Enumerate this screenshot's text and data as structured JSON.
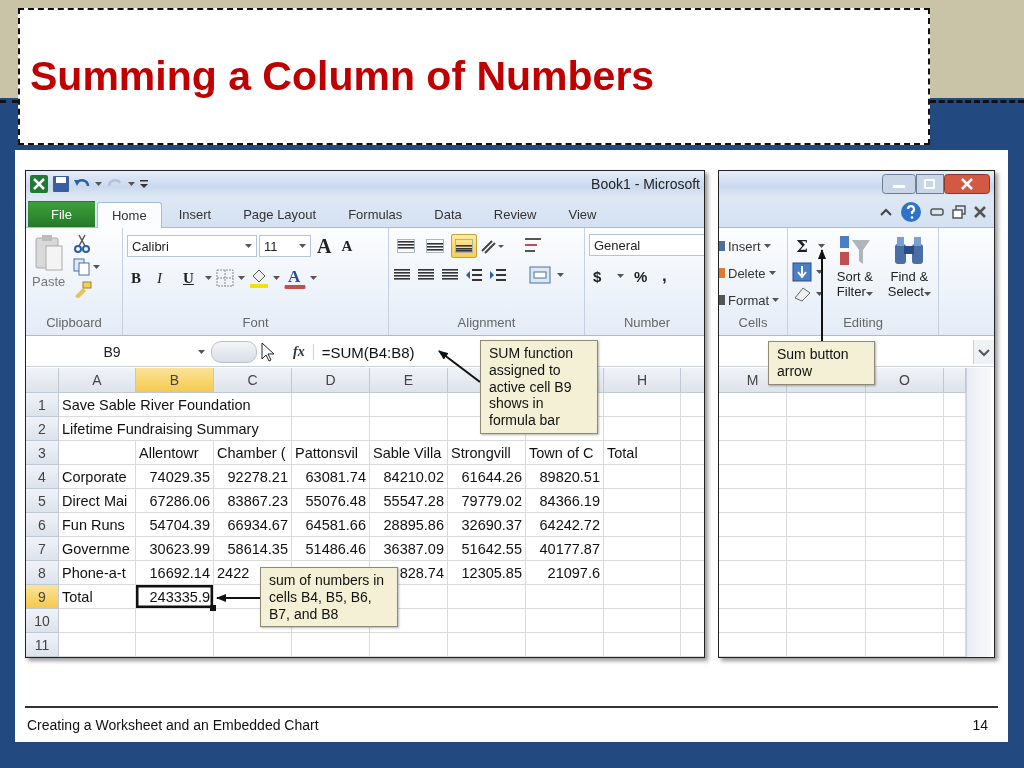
{
  "slide": {
    "title": "Summing a Column of Numbers",
    "footer": "Creating a Worksheet and an Embedded Chart",
    "page": "14"
  },
  "window": {
    "title": "Book1 - Microsoft"
  },
  "tabs": [
    {
      "label": "File",
      "kind": "file",
      "selected": false
    },
    {
      "label": "Home",
      "kind": "tab",
      "selected": true
    },
    {
      "label": "Insert",
      "kind": "tab",
      "selected": false
    },
    {
      "label": "Page Layout",
      "kind": "tab",
      "selected": false
    },
    {
      "label": "Formulas",
      "kind": "tab",
      "selected": false
    },
    {
      "label": "Data",
      "kind": "tab",
      "selected": false
    },
    {
      "label": "Review",
      "kind": "tab",
      "selected": false
    },
    {
      "label": "View",
      "kind": "tab",
      "selected": false
    }
  ],
  "ribbon": {
    "clipboard": {
      "label": "Clipboard",
      "paste": "Paste"
    },
    "font": {
      "label": "Font",
      "name": "Calibri",
      "size": "11",
      "size_buttons": [
        "A",
        "A"
      ],
      "style_buttons": [
        "B",
        "I",
        "U"
      ],
      "color_button": "A"
    },
    "alignment": {
      "label": "Alignment",
      "vertical": [
        {
          "selected": false
        },
        {
          "selected": false
        },
        {
          "selected": true
        }
      ]
    },
    "number": {
      "label": "Number",
      "format": "General",
      "buttons": [
        "$",
        "%",
        ","
      ]
    },
    "cells": {
      "label": "Cells",
      "items": [
        "Insert",
        "Delete",
        "Format"
      ]
    },
    "editing": {
      "label": "Editing",
      "sum": "Σ",
      "buttons": [
        "Sort & Filter",
        "Find & Select"
      ]
    }
  },
  "formula_bar": {
    "name_box": "B9",
    "function_label": "fx",
    "formula": "=SUM(B4:B8)"
  },
  "sheet": {
    "columns": [
      {
        "label": "A",
        "selected": false
      },
      {
        "label": "B",
        "selected": true
      },
      {
        "label": "C",
        "selected": false
      },
      {
        "label": "D",
        "selected": false
      },
      {
        "label": "E",
        "selected": false
      },
      {
        "label": "H",
        "selected": false
      }
    ],
    "right_columns": [
      "M",
      "O"
    ],
    "rows": [
      {
        "header": "1",
        "selected": false,
        "kind": "text",
        "cells": [
          "Save Sable River Foundation",
          null,
          null
        ]
      },
      {
        "header": "2",
        "selected": false,
        "kind": "text",
        "cells": [
          "Lifetime Fundraising Summary",
          null,
          null
        ]
      },
      {
        "header": "3",
        "selected": false,
        "kind": "text",
        "cells": [
          null,
          "Allentowr",
          "Chamber (",
          "Pattonsvil",
          "Sable Villa",
          "Strongvill",
          "Town of C",
          "Total"
        ]
      },
      {
        "header": "4",
        "selected": false,
        "kind": "numbers",
        "cells": [
          "Corporate",
          "74029.35",
          "92278.21",
          "63081.74",
          "84210.02",
          "61644.26",
          "89820.51"
        ]
      },
      {
        "header": "5",
        "selected": false,
        "kind": "numbers",
        "cells": [
          "Direct Mai",
          "67286.06",
          "83867.23",
          "55076.48",
          "55547.28",
          "79779.02",
          "84366.19"
        ]
      },
      {
        "header": "6",
        "selected": false,
        "kind": "numbers",
        "cells": [
          "Fun Runs",
          "54704.39",
          "66934.67",
          "64581.66",
          "28895.86",
          "32690.37",
          "64242.72"
        ]
      },
      {
        "header": "7",
        "selected": false,
        "kind": "numbers",
        "cells": [
          "Governme",
          "30623.99",
          "58614.35",
          "51486.46",
          "36387.09",
          "51642.55",
          "40177.87"
        ]
      },
      {
        "header": "8",
        "selected": false,
        "kind": "numbers",
        "cells": [
          "Phone-a-t",
          "16692.14",
          {
            "text": "2422",
            "clipped": true
          },
          null,
          {
            "text": "828.74"
          },
          "12305.85",
          "21097.6"
        ]
      },
      {
        "header": "9",
        "selected": true,
        "kind": "numbers",
        "cells": [
          "Total",
          {
            "text": "243335.9",
            "active": true
          }
        ]
      },
      {
        "header": "10",
        "selected": false
      },
      {
        "header": "11",
        "selected": false
      }
    ]
  },
  "callouts": [
    {
      "text": "SUM function assigned to active cell B9 shows in formula bar"
    },
    {
      "text": "sum of numbers in cells B4, B5, B6, B7, and B8"
    },
    {
      "text": "Sum button arrow"
    }
  ]
}
